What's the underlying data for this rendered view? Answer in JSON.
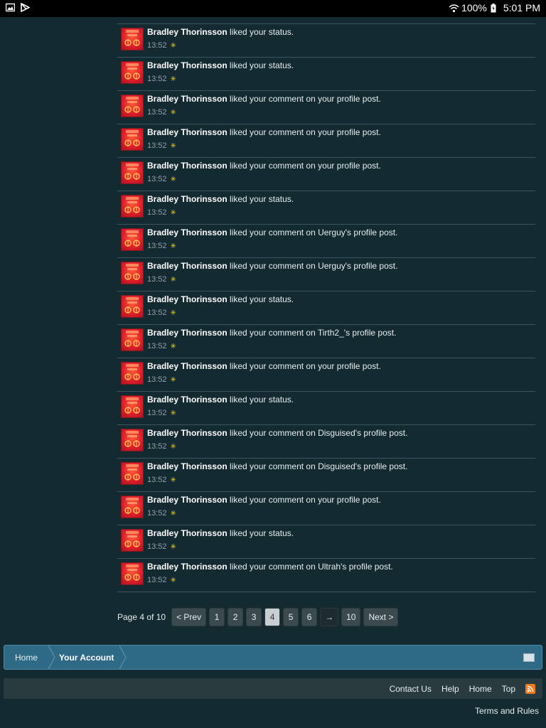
{
  "status_bar": {
    "battery": "100%",
    "time": "5:01 PM"
  },
  "alerts": [
    {
      "user": "Bradley Thorinsson",
      "action": "liked your status.",
      "time": "13:52"
    },
    {
      "user": "Bradley Thorinsson",
      "action": "liked your status.",
      "time": "13:52"
    },
    {
      "user": "Bradley Thorinsson",
      "action": "liked your comment on your profile post.",
      "time": "13:52"
    },
    {
      "user": "Bradley Thorinsson",
      "action": "liked your comment on your profile post.",
      "time": "13:52"
    },
    {
      "user": "Bradley Thorinsson",
      "action": "liked your comment on your profile post.",
      "time": "13:52"
    },
    {
      "user": "Bradley Thorinsson",
      "action": "liked your status.",
      "time": "13:52"
    },
    {
      "user": "Bradley Thorinsson",
      "action": "liked your comment on Uerguy's profile post.",
      "time": "13:52"
    },
    {
      "user": "Bradley Thorinsson",
      "action": "liked your comment on Uerguy's profile post.",
      "time": "13:52"
    },
    {
      "user": "Bradley Thorinsson",
      "action": "liked your status.",
      "time": "13:52"
    },
    {
      "user": "Bradley Thorinsson",
      "action": "liked your comment on Tirth2_'s profile post.",
      "time": "13:52"
    },
    {
      "user": "Bradley Thorinsson",
      "action": "liked your comment on your profile post.",
      "time": "13:52"
    },
    {
      "user": "Bradley Thorinsson",
      "action": "liked your status.",
      "time": "13:52"
    },
    {
      "user": "Bradley Thorinsson",
      "action": "liked your comment on Disguised's profile post.",
      "time": "13:52"
    },
    {
      "user": "Bradley Thorinsson",
      "action": "liked your comment on Disguised's profile post.",
      "time": "13:52"
    },
    {
      "user": "Bradley Thorinsson",
      "action": "liked your comment on your profile post.",
      "time": "13:52"
    },
    {
      "user": "Bradley Thorinsson",
      "action": "liked your status.",
      "time": "13:52"
    },
    {
      "user": "Bradley Thorinsson",
      "action": "liked your comment on Ultrah's profile post.",
      "time": "13:52"
    }
  ],
  "pagination": {
    "label": "Page 4 of 10",
    "prev": "< Prev",
    "pages": [
      "1",
      "2",
      "3",
      "4",
      "5",
      "6"
    ],
    "current": "4",
    "skip": "→",
    "last": "10",
    "next": "Next >"
  },
  "breadcrumb": {
    "home": "Home",
    "account": "Your Account"
  },
  "footer": {
    "links": [
      "Contact Us",
      "Help",
      "Home",
      "Top"
    ],
    "terms": "Terms and Rules"
  },
  "colors": {
    "background": "#132a31",
    "breadcrumb_bg": "#2e6a86",
    "like_icon": "#f5d300",
    "rss": "#f07a1c"
  }
}
